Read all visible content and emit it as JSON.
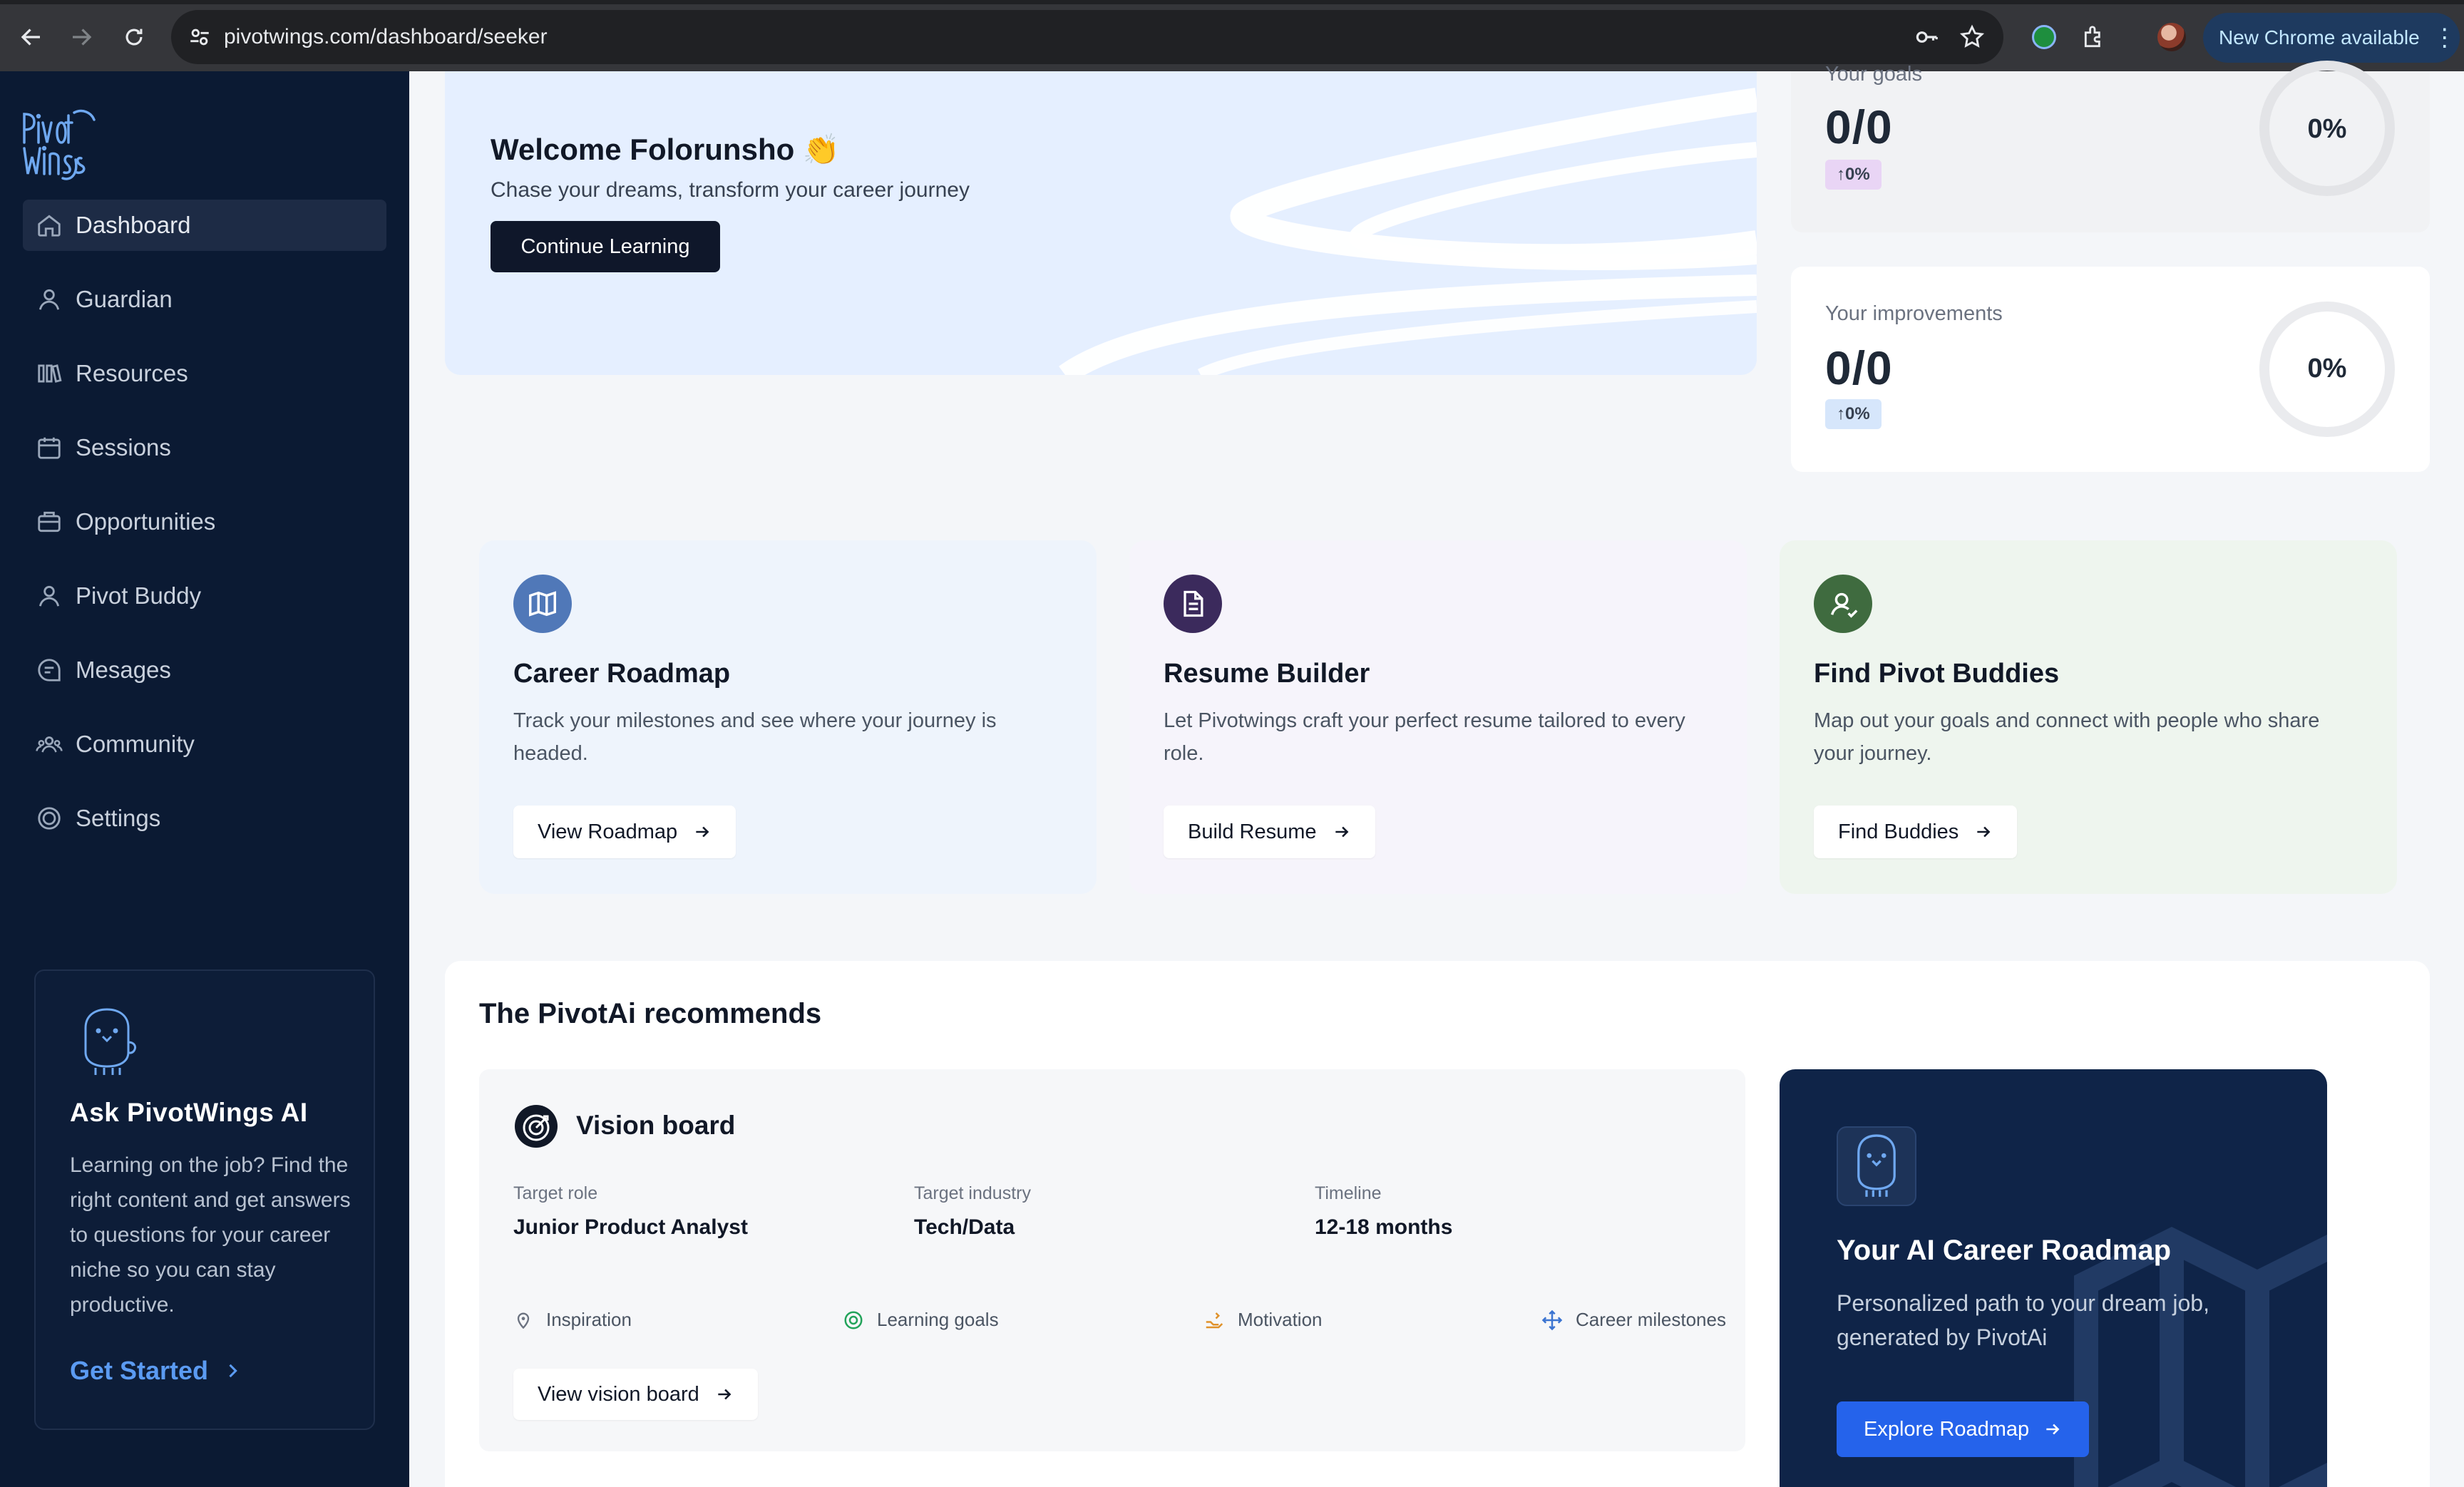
{
  "browser": {
    "url": "pivotwings.com/dashboard/seeker",
    "update_label": "New Chrome available"
  },
  "sidebar": {
    "logo_text": "Pivot Wings",
    "items": [
      {
        "label": "Dashboard",
        "icon": "home-icon",
        "active": true
      },
      {
        "label": "Guardian",
        "icon": "user-icon"
      },
      {
        "label": "Resources",
        "icon": "resources-icon"
      },
      {
        "label": "Sessions",
        "icon": "calendar-icon"
      },
      {
        "label": "Opportunities",
        "icon": "briefcase-icon"
      },
      {
        "label": "Pivot Buddy",
        "icon": "user-icon"
      },
      {
        "label": "Mesages",
        "icon": "message-icon"
      },
      {
        "label": "Community",
        "icon": "community-icon"
      },
      {
        "label": "Settings",
        "icon": "settings-icon"
      }
    ],
    "ai_card": {
      "title": "Ask PivotWings AI",
      "description": "Learning on the job? Find the right content and get answers to questions for your career niche so you can stay productive.",
      "cta": "Get Started"
    }
  },
  "hero": {
    "title": "Welcome Folorunsho 👏",
    "subtitle": "Chase your dreams, transform your career journey",
    "button": "Continue Learning"
  },
  "stats": [
    {
      "label": "Your goals",
      "value": "0/0",
      "change": "↑0%",
      "percent": "0%",
      "badge_color": "#e9d5f5"
    },
    {
      "label": "Your improvements",
      "value": "0/0",
      "change": "↑0%",
      "percent": "0%",
      "badge_color": "#d6e6fb"
    }
  ],
  "features": [
    {
      "title": "Career Roadmap",
      "description": "Track your milestones and see where your journey is headed.",
      "button": "View Roadmap",
      "icon": "map-icon",
      "color": "#5078b8",
      "bg": "#eef4fc"
    },
    {
      "title": "Resume Builder",
      "description": "Let Pivotwings craft your perfect resume tailored to every role.",
      "button": "Build Resume",
      "icon": "document-icon",
      "color": "#3b2a5c",
      "bg": "#f6f4fb"
    },
    {
      "title": "Find Pivot Buddies",
      "description": "Map out your goals and connect with people who share your journey.",
      "button": "Find Buddies",
      "icon": "people-icon",
      "color": "#3f6b3f",
      "bg": "#eef5ee"
    }
  ],
  "recommendations": {
    "title": "The PivotAi recommends",
    "vision": {
      "title": "Vision board",
      "fields": [
        {
          "key": "Target role",
          "value": "Junior Product Analyst"
        },
        {
          "key": "Target industry",
          "value": "Tech/Data"
        },
        {
          "key": "Timeline",
          "value": "12-18 months"
        }
      ],
      "tags": [
        {
          "label": "Inspiration",
          "icon": "pin-icon"
        },
        {
          "label": "Learning goals",
          "icon": "target-icon"
        },
        {
          "label": "Motivation",
          "icon": "motivation-icon"
        },
        {
          "label": "Career milestones",
          "icon": "move-icon"
        }
      ],
      "button": "View vision board"
    },
    "roadmap": {
      "title": "Your AI Career Roadmap",
      "description": "Personalized path to your dream job, generated by PivotAi",
      "button": "Explore Roadmap"
    }
  }
}
